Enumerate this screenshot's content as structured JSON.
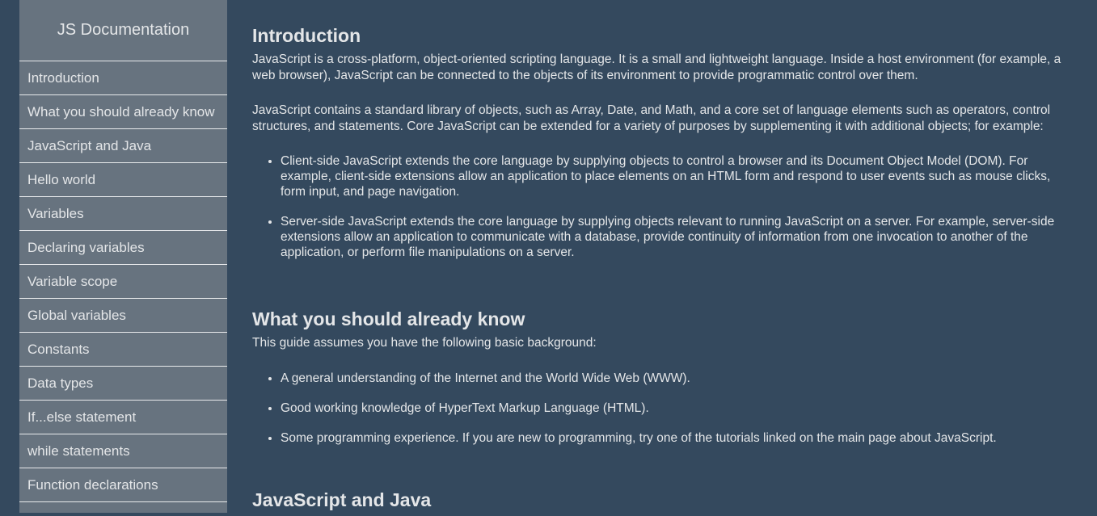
{
  "nav": {
    "title": "JS Documentation",
    "items": [
      "Introduction",
      "What you should already know",
      "JavaScript and Java",
      "Hello world",
      "Variables",
      "Declaring variables",
      "Variable scope",
      "Global variables",
      "Constants",
      "Data types",
      "If...else statement",
      "while statements",
      "Function declarations",
      ""
    ]
  },
  "sections": [
    {
      "title": "Introduction",
      "paragraphs": [
        "JavaScript is a cross-platform, object-oriented scripting language. It is a small and lightweight language. Inside a host environment (for example, a web browser), JavaScript can be connected to the objects of its environment to provide programmatic control over them.",
        "JavaScript contains a standard library of objects, such as Array, Date, and Math, and a core set of language elements such as operators, control structures, and statements. Core JavaScript can be extended for a variety of purposes by supplementing it with additional objects; for example:"
      ],
      "bullets": [
        "Client-side JavaScript extends the core language by supplying objects to control a browser and its Document Object Model (DOM). For example, client-side extensions allow an application to place elements on an HTML form and respond to user events such as mouse clicks, form input, and page navigation.",
        "Server-side JavaScript extends the core language by supplying objects relevant to running JavaScript on a server. For example, server-side extensions allow an application to communicate with a database, provide continuity of information from one invocation to another of the application, or perform file manipulations on a server."
      ]
    },
    {
      "title": "What you should already know",
      "paragraphs": [
        "This guide assumes you have the following basic background:"
      ],
      "bullets": [
        "A general understanding of the Internet and the World Wide Web (WWW).",
        "Good working knowledge of HyperText Markup Language (HTML).",
        "Some programming experience. If you are new to programming, try one of the tutorials linked on the main page about JavaScript."
      ]
    },
    {
      "title": "JavaScript and Java"
    }
  ]
}
